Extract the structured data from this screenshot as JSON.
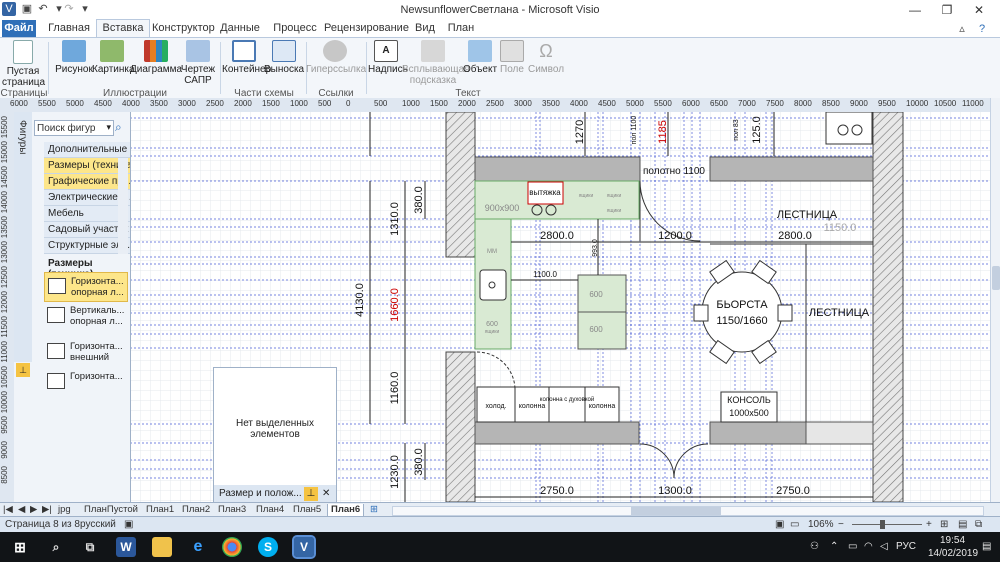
{
  "window": {
    "title": "NewsunflowerСветлана - Microsoft Visio"
  },
  "tabs": [
    "Файл",
    "Главная",
    "Вставка",
    "Конструктор",
    "Данные",
    "Процесс",
    "Рецензирование",
    "Вид",
    "План"
  ],
  "ribbon": {
    "buttons": [
      {
        "label": "Пустая страница",
        "icon": "blank-page-icon"
      },
      {
        "label": "Рисунок",
        "icon": "picture-icon"
      },
      {
        "label": "Картинка",
        "icon": "clipart-icon"
      },
      {
        "label": "Диаграмма",
        "icon": "chart-icon"
      },
      {
        "label": "Чертеж САПР",
        "icon": "cad-icon"
      },
      {
        "label": "Контейнер",
        "icon": "container-icon"
      },
      {
        "label": "Выноска",
        "icon": "callout-icon"
      },
      {
        "label": "Гиперссылка",
        "icon": "hyperlink-icon"
      },
      {
        "label": "Надпись",
        "icon": "textbox-icon"
      },
      {
        "label": "Всплывающая подсказка",
        "icon": "screentip-icon"
      },
      {
        "label": "Объект",
        "icon": "object-icon"
      },
      {
        "label": "Поле",
        "icon": "field-icon"
      },
      {
        "label": "Символ",
        "icon": "symbol-icon"
      }
    ],
    "groups": [
      "Страницы",
      "Иллюстрации",
      "Части схемы",
      "Ссылки",
      "Текст"
    ]
  },
  "ruler": {
    "h_labels": [
      "6000",
      "5500",
      "5000",
      "4500",
      "4000",
      "3500",
      "3000",
      "2500",
      "2000",
      "1500",
      "1000",
      "500",
      "0",
      "500",
      "1000",
      "1500",
      "2000",
      "2500",
      "3000",
      "3500",
      "4000",
      "4500",
      "5000",
      "5500",
      "6000",
      "6500",
      "7000",
      "7500",
      "8000",
      "8500",
      "9000",
      "9500",
      "10000",
      "10500",
      "11000"
    ],
    "v_labels": [
      "15500",
      "15000",
      "14500",
      "14000",
      "13500",
      "13000",
      "12500",
      "12000",
      "11500",
      "11000",
      "10500",
      "10000",
      "9500",
      "9000",
      "8500",
      "8000"
    ]
  },
  "shapes_panel": {
    "title": "Фигуры",
    "search_placeholder": "Поиск фигур",
    "stencils": [
      "Дополнительные фи...",
      "Размеры (техника)",
      "Графические при...",
      "Электрические и ...",
      "Мебель",
      "Садовый участок",
      "Структурные эле..."
    ],
    "section_title": "Размеры (техника)",
    "shapes": [
      {
        "label": "Горизонта... опорная л..."
      },
      {
        "label": "Вертикаль... опорная л..."
      },
      {
        "label": "Горизонта... внешний"
      },
      {
        "label": "Горизонта..."
      }
    ]
  },
  "size_panel": {
    "message": "Нет выделенных элементов",
    "title": "Размер и полож..."
  },
  "plan": {
    "dims": [
      "1310.0",
      "380.0",
      "4130.0",
      "1660.0",
      "1160.0",
      "1230.0",
      "380.0",
      "2800.0",
      "1200.0",
      "2800.0",
      "1150.0",
      "1100.0",
      "2750.0",
      "1300.0",
      "2750.0",
      "1270",
      "1185",
      "125.0",
      "993.0",
      "пол 1100",
      "пол 83"
    ],
    "labels": [
      "вытяжка",
      "900х900",
      "полотно 1100",
      "ЛЕСТНИЦА",
      "ЛЕСТНИЦА",
      "БЬОРСТА",
      "1150/1660",
      "КОНСОЛЬ",
      "1000х500",
      "холод.",
      "колонна",
      "колонна с духовкой",
      "колонна",
      "600",
      "600",
      "ящики",
      "ящики",
      "600",
      "ящики",
      "ящики",
      "ММ"
    ]
  },
  "page_tabs": [
    "jpg",
    "ПланПустой",
    "План1",
    "План2",
    "План3",
    "План4",
    "План5",
    "План6"
  ],
  "status": {
    "page": "Страница 8 из 8",
    "lang": "русский",
    "zoom": "106%"
  },
  "taskbar": {
    "time": "19:54",
    "date": "14/02/2019",
    "lang": "РУС"
  }
}
